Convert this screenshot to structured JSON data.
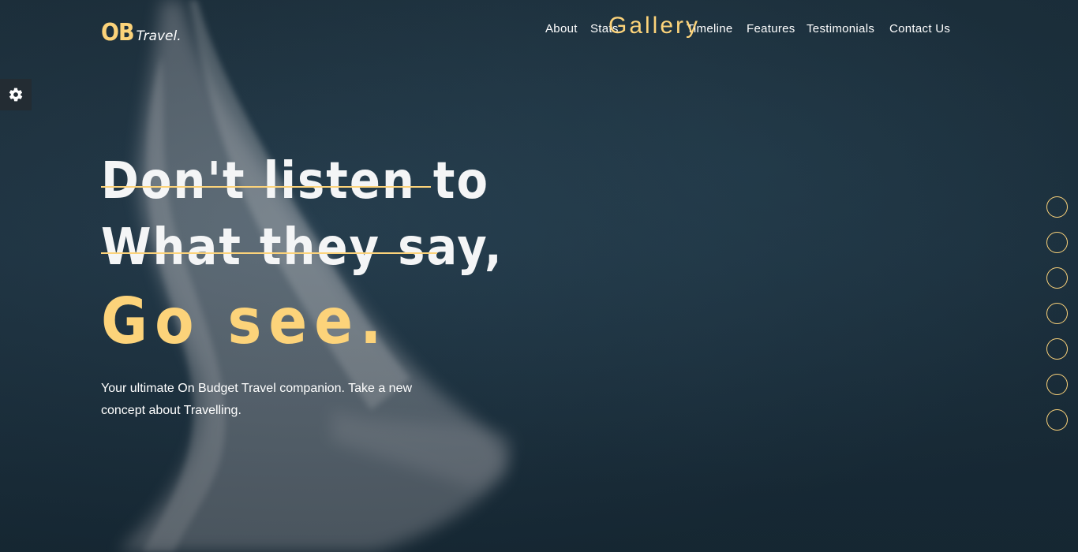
{
  "brand": {
    "logo_bold": "OB",
    "logo_script": "Travel."
  },
  "nav": {
    "about": "About",
    "stats": "Stats",
    "timeline": "Timeline",
    "features": "Features",
    "testimonials": "Testimonials",
    "contact": "Contact Us",
    "hover_overlay": "Gallery"
  },
  "settings": {
    "icon": "gear-icon"
  },
  "hero": {
    "line1": "Don't listen to",
    "line2": "What they say,",
    "line3": "Go see.",
    "tagline": "Your ultimate On Budget Travel companion. Take a new concept about Travelling."
  },
  "section_dots": {
    "count": 7
  },
  "colors": {
    "accent": "#fcd37a",
    "text": "#ffffff",
    "background": "#1f3441"
  }
}
